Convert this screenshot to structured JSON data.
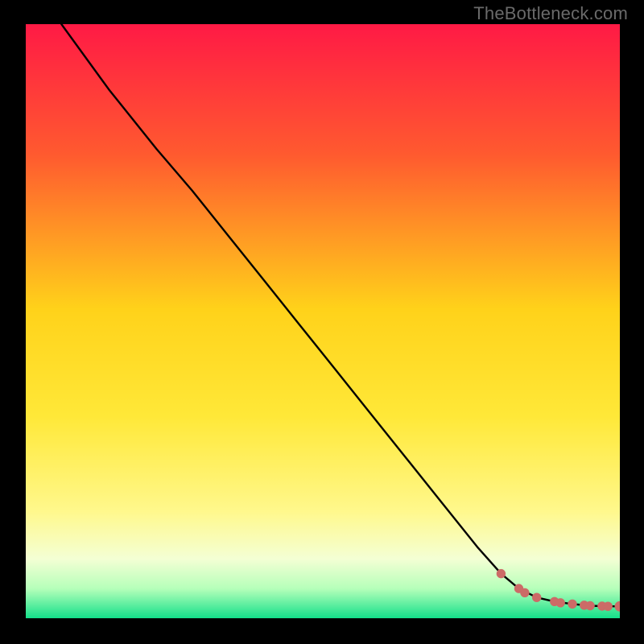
{
  "watermark": "TheBottleneck.com",
  "colors": {
    "background": "#000000",
    "gradient_top": "#ff1a45",
    "gradient_mid_upper": "#ff6a2a",
    "gradient_mid": "#ffd21a",
    "gradient_mid_lower": "#fff88c",
    "gradient_near_bottom": "#c8ffb0",
    "gradient_bottom": "#14e08a",
    "line": "#000000",
    "dot_fill": "#cc6b67",
    "dot_stroke": "#cc6b67"
  },
  "chart_data": {
    "type": "line",
    "title": "",
    "xlabel": "",
    "ylabel": "",
    "xlim": [
      0,
      100
    ],
    "ylim": [
      0,
      100
    ],
    "series": [
      {
        "name": "curve",
        "x": [
          6,
          14,
          22,
          28,
          34,
          40,
          46,
          52,
          58,
          64,
          70,
          76,
          80,
          83,
          86,
          89,
          92,
          95,
          98,
          100
        ],
        "y": [
          100,
          89,
          79,
          72,
          64.5,
          57,
          49.5,
          42,
          34.5,
          27,
          19.5,
          12,
          7.5,
          5,
          3.5,
          2.8,
          2.4,
          2.1,
          2.0,
          2.0
        ]
      }
    ],
    "dot_segment": {
      "name": "tail-dots",
      "x": [
        80,
        83,
        84,
        86,
        89,
        90,
        92,
        94,
        95,
        97,
        98,
        100
      ],
      "y": [
        7.5,
        5,
        4.3,
        3.5,
        2.8,
        2.6,
        2.4,
        2.2,
        2.1,
        2.05,
        2.0,
        2.0
      ]
    }
  }
}
